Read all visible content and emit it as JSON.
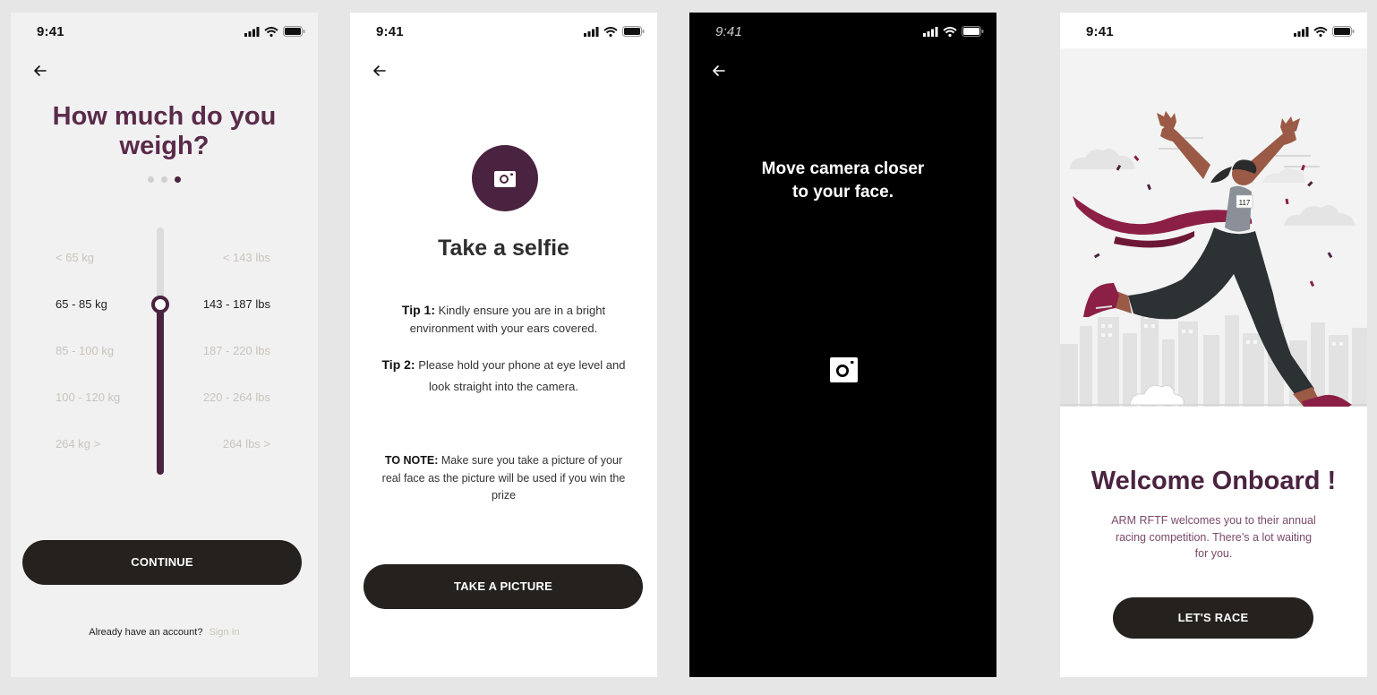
{
  "status_time": "9:41",
  "colors": {
    "brand": "#4a2340",
    "button": "#24211e",
    "muted": "#c9c4bd"
  },
  "screen1": {
    "title_line1": "How much do you",
    "title_line2": "weigh?",
    "step_indicator": {
      "total": 3,
      "current": 3
    },
    "options": [
      {
        "kg": "< 65 kg",
        "lbs": "< 143 lbs"
      },
      {
        "kg": "65 - 85 kg",
        "lbs": "143 - 187 lbs"
      },
      {
        "kg": "85 - 100 kg",
        "lbs": "187 - 220 lbs"
      },
      {
        "kg": "100 - 120 kg",
        "lbs": "220 - 264 lbs"
      },
      {
        "kg": "264 kg >",
        "lbs": "264 lbs >"
      }
    ],
    "selected_index": 1,
    "continue_label": "CONTINUE",
    "account_prompt": "Already have an account?",
    "sign_in_label": "Sign In"
  },
  "screen2": {
    "title": "Take a selfie",
    "tip1_label": "Tip 1:",
    "tip1_text": "Kindly ensure you are in a bright environment with your ears covered.",
    "tip2_label": "Tip 2:",
    "tip2_text": "Please hold your phone at eye level and look straight into the camera.",
    "note_label": "TO NOTE:",
    "note_text": "Make sure you take a picture of your real face as the picture will be used if you win the prize",
    "button_label": "TAKE A PICTURE"
  },
  "screen3": {
    "title_line1": "Move camera closer",
    "title_line2": "to your face."
  },
  "screen4": {
    "bib_number": "117",
    "title": "Welcome Onboard !",
    "desc": "ARM RFTF welcomes you to their annual racing competition. There’s a lot waiting for you.",
    "button_label": "LET'S RACE"
  }
}
